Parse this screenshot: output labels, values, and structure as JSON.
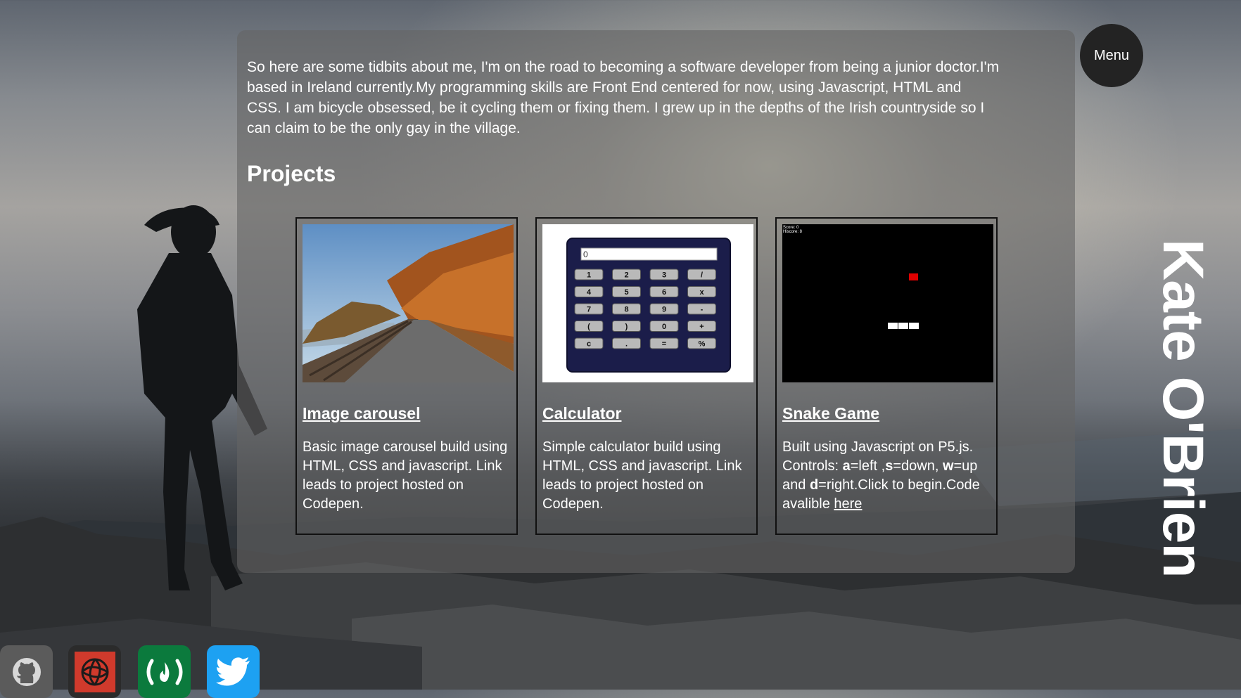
{
  "header": {
    "menu_label": "Menu",
    "name": "Kate O'Brien"
  },
  "about": {
    "bio": "So here are some tidbits about me, I'm on the road to becoming a software developer from being a junior doctor.I'm based in Ireland currently.My programming skills are Front End centered for now, using Javascript, HTML and CSS. I am bicycle obsessed, be it cycling them or fixing them. I grew up in the depths of the Irish countryside so I can claim to be the only gay in the village."
  },
  "projects": {
    "heading": "Projects",
    "items": [
      {
        "title": "Image carousel",
        "description": "Basic image carousel build using HTML, CSS and javascript. Link leads to project hosted on Codepen."
      },
      {
        "title": "Calculator",
        "description": "Simple calculator build using HTML, CSS and javascript. Link leads to project hosted on Codepen.",
        "calc_display": "0",
        "calc_keys": [
          "1",
          "2",
          "3",
          "/",
          "4",
          "5",
          "6",
          "x",
          "7",
          "8",
          "9",
          "-",
          "(",
          ")",
          "0",
          "+",
          "c",
          ".",
          "=",
          "%"
        ]
      },
      {
        "title": "Snake Game",
        "description_parts": {
          "p1": "Built using Javascript on P5.js. Controls: ",
          "k1": "a",
          "p2": "=left ,",
          "k2": "s",
          "p3": "=down, ",
          "k3": "w",
          "p4": "=up and ",
          "k4": "d",
          "p5": "=right.Click to begin.Code avalible ",
          "link": "here"
        },
        "score": "Score: 0",
        "hiscore": "Hiscore: 8"
      }
    ]
  },
  "social": [
    {
      "icon": "github-icon"
    },
    {
      "icon": "codepen-icon"
    },
    {
      "icon": "freecodecamp-icon"
    },
    {
      "icon": "twitter-icon"
    }
  ]
}
